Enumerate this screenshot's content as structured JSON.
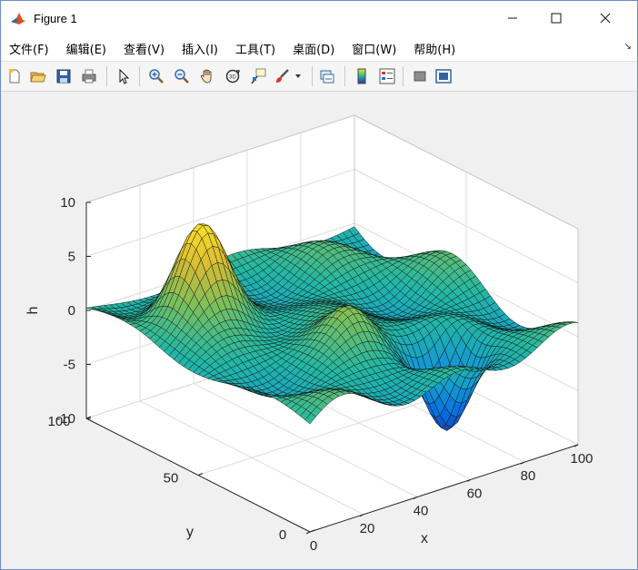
{
  "window": {
    "title": "Figure 1",
    "minimize_label": "—",
    "maximize_label": "☐",
    "close_label": "✕"
  },
  "menu": {
    "items": [
      "文件(F)",
      "编辑(E)",
      "查看(V)",
      "插入(I)",
      "工具(T)",
      "桌面(D)",
      "窗口(W)",
      "帮助(H)"
    ],
    "overflow_glyph": "↘"
  },
  "toolbar": {
    "buttons": [
      "new-figure-icon",
      "open-file-icon",
      "save-icon",
      "print-icon",
      "edit-plot-icon",
      "zoom-in-icon",
      "zoom-out-icon",
      "pan-hand-icon",
      "rotate-3d-icon",
      "data-cursor-icon",
      "brush-icon",
      "link-plot-icon",
      "colorbar-icon",
      "legend-icon",
      "hide-plot-tools-icon",
      "show-plot-tools-icon"
    ]
  },
  "chart_data": {
    "type": "surface",
    "title": "",
    "xlabel": "x",
    "ylabel": "y",
    "zlabel": "h",
    "xlim": [
      0,
      100
    ],
    "ylim": [
      0,
      100
    ],
    "zlim": [
      -10,
      10
    ],
    "x_ticks": [
      "0",
      "20",
      "40",
      "60",
      "80",
      "100"
    ],
    "y_ticks": [
      "0",
      "50",
      "100"
    ],
    "z_ticks": [
      "10",
      "5",
      "0",
      "-5",
      "-10"
    ],
    "colormap": "parula",
    "grid": true,
    "features": [
      {
        "kind": "peak",
        "x": 22,
        "y": 75,
        "h": 8.5
      },
      {
        "kind": "peak",
        "x": 45,
        "y": 35,
        "h": 3
      },
      {
        "kind": "valley",
        "x": 68,
        "y": 20,
        "h": -9
      }
    ]
  }
}
